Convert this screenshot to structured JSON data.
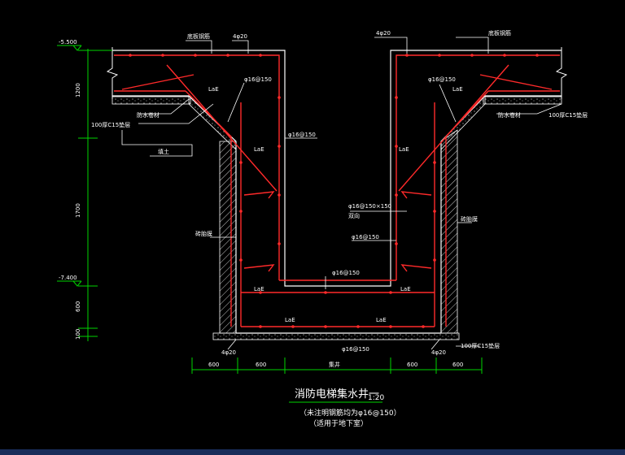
{
  "drawing": {
    "title": "消防电梯集水井一",
    "scale": "1:20",
    "note_line1": "（未注明钢筋均为φ16@150）",
    "note_line2": "（适用于地下室）"
  },
  "elevations": {
    "top": "-5.500",
    "bottom": "-7.400"
  },
  "vertical_dims": [
    "1200",
    "1700",
    "600",
    "100"
  ],
  "horizontal_dims": [
    "600",
    "600",
    "集井",
    "600",
    "600"
  ],
  "labels": {
    "slab_rebar_left": "底板钢筋",
    "slab_rebar_right": "底板钢筋",
    "wall_left_top": "φ16@150",
    "rebar_ring_left": "φ16@150",
    "cushion_left": "100厚C15垫层",
    "cushion_right": "100厚C15垫层",
    "waterproof_left": "防水卷材",
    "waterproof_right": "防水卷材",
    "fill_left": "砖胎膜",
    "fill_right": "砖胎膜",
    "backfill": "填土",
    "inner_bars": "φ16@150×150",
    "inner_bars_sub": "双向",
    "wall_mid": "φ16@150",
    "bottom_slab": "φ16@150",
    "bottom_label": "φ16@150",
    "bottom_cushion": "100厚C15垫层",
    "anchor_left": "4φ20",
    "anchor_right": "4φ20",
    "anchor_top_left": "4φ20",
    "anchor_top_right": "4φ20",
    "lae": "LaE"
  },
  "colors": {
    "background": "#000000",
    "concrete": "#ffffff",
    "rebar": "#ff2a2a",
    "dimension": "#00d400",
    "text": "#ffffff",
    "hatch": "#c8c8c8"
  }
}
